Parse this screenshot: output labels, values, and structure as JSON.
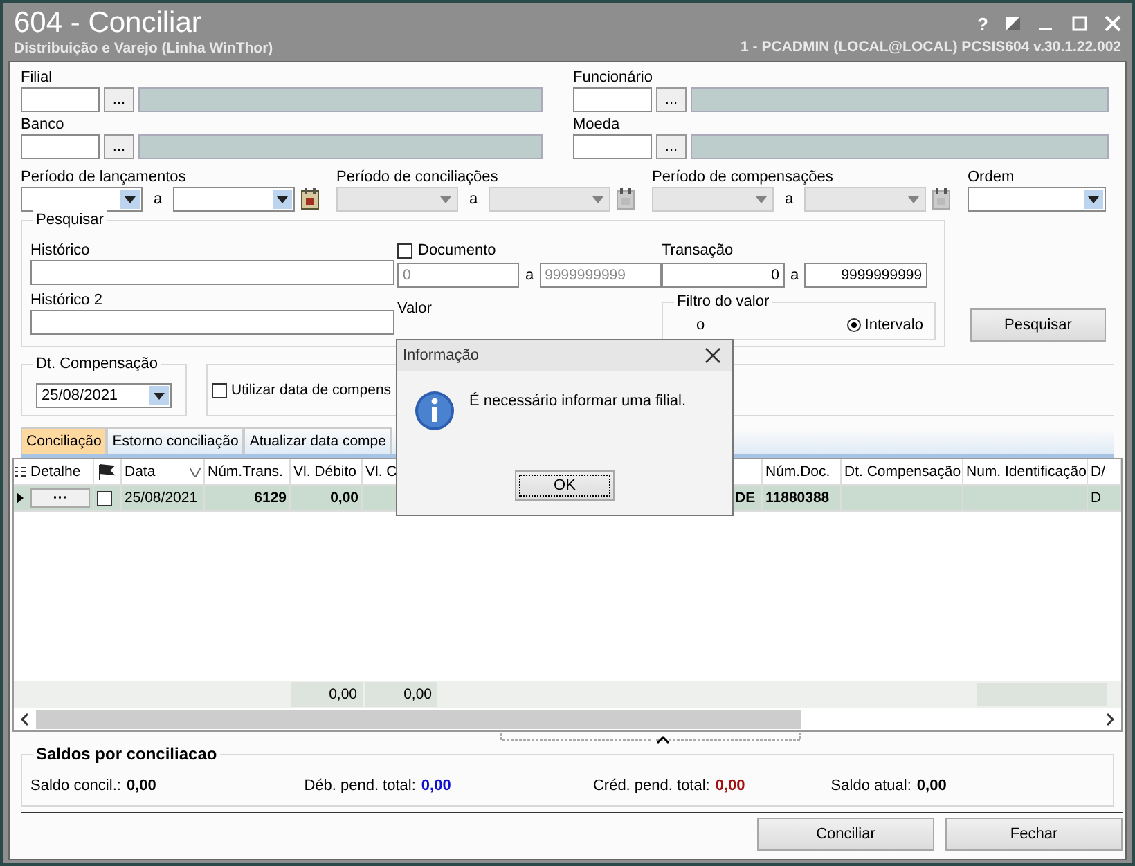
{
  "window": {
    "title": "604 - Conciliar",
    "subtitle": "Distribuição e Varejo (Linha WinThor)",
    "session": "1 - PCADMIN (LOCAL@LOCAL)   PCSIS604   v.30.1.22.002",
    "help": "?"
  },
  "lookups": [
    {
      "label": "Filial",
      "button": "..."
    },
    {
      "label": "Funcionário",
      "button": "..."
    },
    {
      "label": "Banco",
      "button": "..."
    },
    {
      "label": "Moeda",
      "button": "..."
    }
  ],
  "periods": [
    {
      "label": "Período de lançamentos",
      "separator": "a",
      "disabled": false
    },
    {
      "label": "Período de conciliações",
      "separator": "a",
      "disabled": true
    },
    {
      "label": "Período de compensações",
      "separator": "a",
      "disabled": true
    }
  ],
  "ordem": {
    "label": "Ordem"
  },
  "search": {
    "title": "Pesquisar",
    "historico": "Histórico",
    "historico2": "Histórico 2",
    "documento": {
      "label": "Documento",
      "checked": false,
      "from": "0",
      "sep": "a",
      "to": "9999999999"
    },
    "valor": "Valor",
    "transacao": {
      "label": "Transação",
      "from": "0",
      "sep": "a",
      "to": "9999999999"
    },
    "filtro": {
      "title": "Filtro do valor",
      "fragment": "o",
      "option": "Intervalo",
      "selected": true
    },
    "button": "Pesquisar"
  },
  "dt_compensacao": {
    "title": "Dt. Compensação",
    "value": "25/08/2021",
    "utilizar": "Utilizar data de compens",
    "checked": false
  },
  "tabs": [
    {
      "label": "Conciliação",
      "selected": true
    },
    {
      "label": "Estorno conciliação",
      "selected": false
    },
    {
      "label": "Atualizar data compe",
      "selected": false
    }
  ],
  "table": {
    "columns": [
      "Detalhe",
      "",
      "Data",
      "Núm.Trans.",
      "Vl. Débito",
      "Vl. C",
      "",
      "",
      "Núm.Doc.",
      "Dt. Compensação",
      "Num. Identificação",
      "D/"
    ],
    "rows": [
      {
        "selected": true,
        "checked": false,
        "cells": [
          "···",
          "",
          "25/08/2021",
          "6129",
          "0,00",
          "",
          "",
          "DE",
          "11880388",
          "",
          "",
          "D"
        ]
      }
    ],
    "totals": [
      "0,00",
      "0,00"
    ]
  },
  "saldos": {
    "title": "Saldos por conciliacao",
    "items": [
      {
        "label": "Saldo concil.:",
        "value": "0,00",
        "color": "#000000"
      },
      {
        "label": "Déb. pend. total:",
        "value": "0,00",
        "color": "#1010d0"
      },
      {
        "label": "Créd. pend. total:",
        "value": "0,00",
        "color": "#a01010"
      },
      {
        "label": "Saldo atual:",
        "value": "0,00",
        "color": "#000000"
      }
    ]
  },
  "buttons": [
    "Conciliar",
    "Fechar"
  ],
  "dialog": {
    "title": "Informação",
    "message": "É necessário informar uma filial.",
    "button": "OK"
  }
}
